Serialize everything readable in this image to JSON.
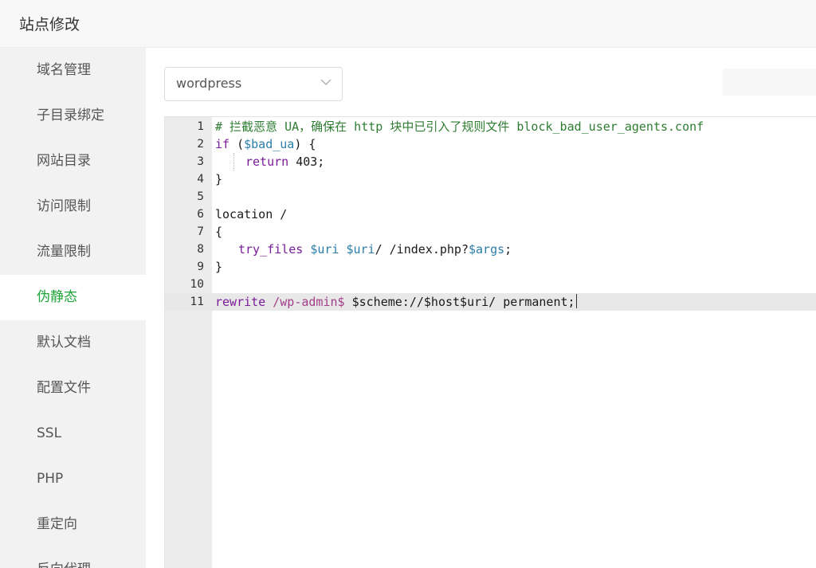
{
  "header": {
    "title": "站点修改"
  },
  "sidebar": {
    "items": [
      {
        "label": "域名管理"
      },
      {
        "label": "子目录绑定"
      },
      {
        "label": "网站目录"
      },
      {
        "label": "访问限制"
      },
      {
        "label": "流量限制"
      },
      {
        "label": "伪静态",
        "active": true
      },
      {
        "label": "默认文档"
      },
      {
        "label": "配置文件"
      },
      {
        "label": "SSL"
      },
      {
        "label": "PHP"
      },
      {
        "label": "重定向"
      },
      {
        "label": "反向代理"
      }
    ]
  },
  "template_select": {
    "value": "wordpress"
  },
  "editor": {
    "active_line": 11,
    "lines": [
      {
        "n": "1",
        "comment": "# 拦截恶意 UA，确保在 http 块中已引入了规则文件 block_bad_user_agents.conf"
      },
      {
        "n": "2",
        "kw": "if",
        "t1": " (",
        "var": "$bad_ua",
        "t2": ") {"
      },
      {
        "n": "3",
        "kw": "return",
        "t1": " 403;"
      },
      {
        "n": "4",
        "t1": "}"
      },
      {
        "n": "5",
        "t1": ""
      },
      {
        "n": "6",
        "t1": "location /"
      },
      {
        "n": "7",
        "t1": "{"
      },
      {
        "n": "8",
        "kw": "try_files",
        "t1": " ",
        "var": "$uri",
        "t2": " ",
        "var2": "$uri",
        "t3": "/ /index.php?",
        "var3": "$args",
        "t4": ";"
      },
      {
        "n": "9",
        "t1": "}"
      },
      {
        "n": "10",
        "t1": ""
      },
      {
        "n": "11",
        "kw": "rewrite",
        "t1": " ",
        "str": "/wp-admin$",
        "t2": " $scheme://$host$uri/ permanent;"
      }
    ]
  },
  "colors": {
    "accent": "#20a53a",
    "comment": "#2e7d32",
    "keyword": "#7a1c9a",
    "variable": "#2b7ea8"
  }
}
